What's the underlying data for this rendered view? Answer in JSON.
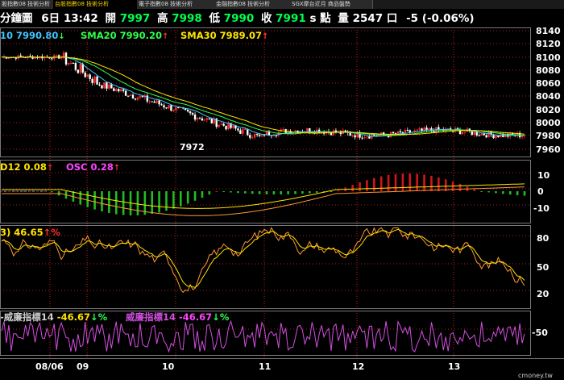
{
  "tabs": [
    {
      "label": "股指數08 技術分析",
      "active": false
    },
    {
      "label": "台股指數08 技術分析",
      "active": true
    },
    {
      "label": "電子指數08 技術分析",
      "active": false
    },
    {
      "label": "金融指數08 技術分析",
      "active": false
    },
    {
      "label": "SGX摩台近月 商品盤勢",
      "active": false
    }
  ],
  "quote": {
    "period": "分鐘圖",
    "day": "6日",
    "time": "13:42",
    "open_label": "開",
    "open": "7997",
    "high_label": "高",
    "high": "7998",
    "low_label": "低",
    "low": "7990",
    "close_label": "收",
    "close": "7991",
    "unit": "s 點",
    "volume_label": "量",
    "volume": "2547",
    "volume_unit": "口",
    "change": "-5 (-0.06%)"
  },
  "price_panel": {
    "indicators": [
      {
        "text": "10 7990.80",
        "arrow": "↓",
        "color": "cyan",
        "arrow_color": "green"
      },
      {
        "text": "SMA20 7990.20",
        "arrow": "↑",
        "color": "green",
        "arrow_color": "red"
      },
      {
        "text": "SMA30 7989.07",
        "arrow": "↑",
        "color": "yellow",
        "arrow_color": "red"
      }
    ],
    "y_ticks": [
      "8140",
      "8120",
      "8100",
      "8080",
      "8060",
      "8040",
      "8020",
      "8000",
      "7980",
      "7960"
    ],
    "low_label": "7972"
  },
  "macd_panel": {
    "indicators": [
      {
        "text": "D12 0.08",
        "arrow": "↑",
        "color": "yellow",
        "arrow_color": "red"
      },
      {
        "text": "OSC 0.28",
        "arrow": "↑",
        "color": "magenta",
        "arrow_color": "red"
      }
    ],
    "y_ticks": [
      "10",
      "0",
      "-10"
    ]
  },
  "kd_panel": {
    "indicators": [
      {
        "text": "3) 46.65",
        "arrow": "↑%",
        "color": "yellow",
        "arrow_color": "red"
      }
    ],
    "y_ticks": [
      "80",
      "50",
      "20"
    ]
  },
  "williams_panel": {
    "indicators": [
      {
        "text": "-威廉指標14",
        "value": "-46.67",
        "arrow": "↓%",
        "color": "gray",
        "arrow_color": "green"
      },
      {
        "text": "威廉指標14",
        "value": "-46.67",
        "arrow": "↓%",
        "color": "magenta2",
        "arrow_color": "green"
      }
    ],
    "y_ticks": [
      "-50"
    ]
  },
  "x_axis": {
    "dates": [
      "08/06",
      "09",
      "10",
      "11",
      "12",
      "13"
    ]
  },
  "watermark": "cmoney.tw",
  "colors": {
    "up_candle": "#ff2a2a",
    "down_candle": "#ffffff",
    "sma10": "#3fc6ff",
    "sma20": "#2eff4e",
    "sma30": "#ffe400",
    "macd_pos": "#d01818",
    "macd_neg": "#1fbf1f",
    "k_line": "#ff9933",
    "d_line": "#ffe400",
    "williams": "#d34fe0"
  }
}
